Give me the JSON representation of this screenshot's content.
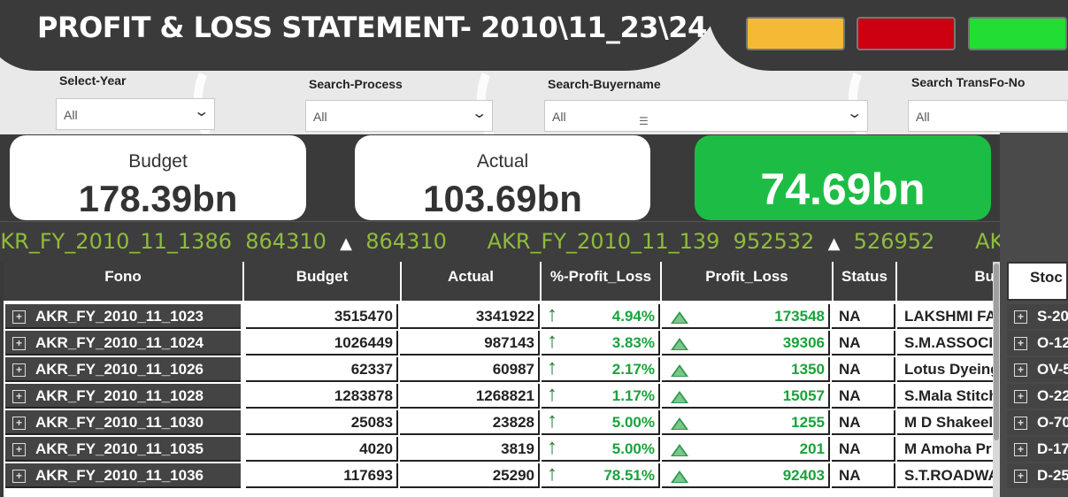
{
  "title": "PROFIT & LOSS STATEMENT- 2010\\11_23\\24",
  "lights": [
    "yellow",
    "red",
    "green"
  ],
  "colors": {
    "yellow": "#f4b935",
    "red": "#cc0011",
    "green": "#22dd33",
    "kpi_green": "#1dbd45",
    "ticker_text": "#8fbc3b",
    "positive": "#18a33a"
  },
  "filters": [
    {
      "label": "Select-Year",
      "value": "All"
    },
    {
      "label": "Search-Process",
      "value": "All"
    },
    {
      "label": "Search-Buyername",
      "value": "All"
    },
    {
      "label": "Search TransFo-No",
      "value": "All"
    }
  ],
  "kpis": {
    "budget_label": "Budget",
    "budget_value": "178.39bn",
    "actual_label": "Actual",
    "actual_value": "103.69bn",
    "profit_value": "74.69bn"
  },
  "ticker": [
    {
      "fono": "AKR_FY_2010_11_1386",
      "v1": "864310",
      "v2": "864310"
    },
    {
      "fono": "AKR_FY_2010_11_139",
      "v1": "952532",
      "v2": "526952"
    },
    {
      "fono": "AKR_FY_",
      "v1": "",
      "v2": ""
    }
  ],
  "table": {
    "headers": {
      "fono": "Fono",
      "budget": "Budget",
      "actual": "Actual",
      "pct": "%-Profit_Loss",
      "pl": "Profit_Loss",
      "status": "Status",
      "buyer": "Bu"
    },
    "rows": [
      {
        "fono": "AKR_FY_2010_11_1023",
        "budget": "3515470",
        "actual": "3341922",
        "pct": "4.94%",
        "pl": "173548",
        "status": "NA",
        "buyer": "LAKSHMI FA"
      },
      {
        "fono": "AKR_FY_2010_11_1024",
        "budget": "1026449",
        "actual": "987143",
        "pct": "3.83%",
        "pl": "39306",
        "status": "NA",
        "buyer": "S.M.ASSOCIA"
      },
      {
        "fono": "AKR_FY_2010_11_1026",
        "budget": "62337",
        "actual": "60987",
        "pct": "2.17%",
        "pl": "1350",
        "status": "NA",
        "buyer": "Lotus Dyeing"
      },
      {
        "fono": "AKR_FY_2010_11_1028",
        "budget": "1283878",
        "actual": "1268821",
        "pct": "1.17%",
        "pl": "15057",
        "status": "NA",
        "buyer": "S.Mala Stitch"
      },
      {
        "fono": "AKR_FY_2010_11_1030",
        "budget": "25083",
        "actual": "23828",
        "pct": "5.00%",
        "pl": "1255",
        "status": "NA",
        "buyer": "M D Shakeel"
      },
      {
        "fono": "AKR_FY_2010_11_1035",
        "budget": "4020",
        "actual": "3819",
        "pct": "5.00%",
        "pl": "201",
        "status": "NA",
        "buyer": "M Amoha Pr"
      },
      {
        "fono": "AKR_FY_2010_11_1036",
        "budget": "117693",
        "actual": "25290",
        "pct": "78.51%",
        "pl": "92403",
        "status": "NA",
        "buyer": "S.T.ROADWA"
      }
    ]
  },
  "stock": {
    "header": "Stoc",
    "rows": [
      "S-20",
      "O-12",
      "OV-5",
      "O-22",
      "O-70",
      "D-17",
      "D-25"
    ]
  }
}
